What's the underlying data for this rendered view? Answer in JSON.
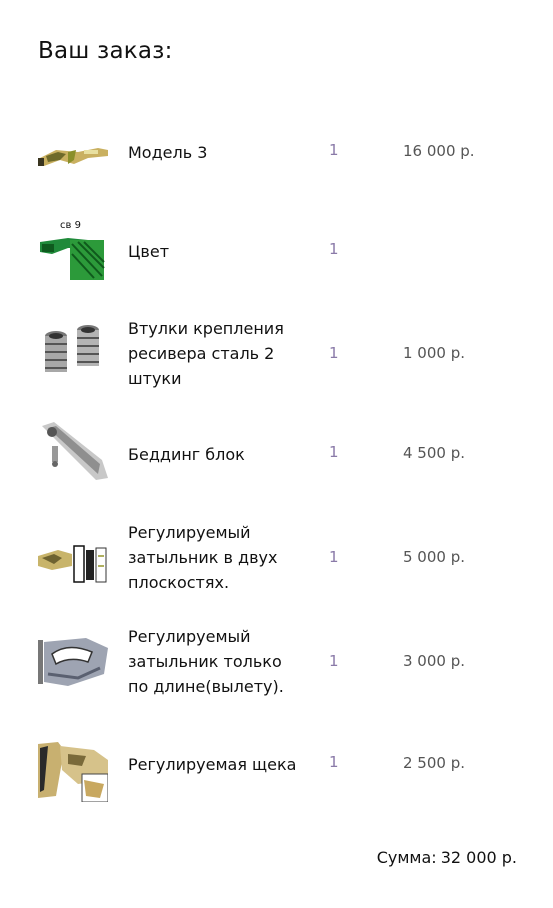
{
  "order": {
    "title": "Ваш заказ:",
    "items": [
      {
        "name": "Модель 3",
        "quantity": "1",
        "price": "16 000 р.",
        "thumbnail_icon": "rifle-stock-icon"
      },
      {
        "name": "Цвет",
        "quantity": "1",
        "price": "",
        "thumbnail_icon": "color-swatch-icon",
        "thumbnail_caption": "св 9"
      },
      {
        "name": "Втулки крепления ресивера сталь 2 штуки",
        "quantity": "1",
        "price": "1 000 р.",
        "thumbnail_icon": "steel-bushings-icon"
      },
      {
        "name": "Беддинг блок",
        "quantity": "1",
        "price": "4 500 р.",
        "thumbnail_icon": "bedding-block-icon"
      },
      {
        "name": "Регулируемый затыльник в двух плоскостях.",
        "quantity": "1",
        "price": "5 000 р.",
        "thumbnail_icon": "adjustable-buttplate-icon"
      },
      {
        "name": "Регулируемый затыльник только по длине(вылету).",
        "quantity": "1",
        "price": "3 000 р.",
        "thumbnail_icon": "length-buttplate-icon"
      },
      {
        "name": "Регулируемая щека",
        "quantity": "1",
        "price": "2 500 р.",
        "thumbnail_icon": "cheek-riser-icon"
      }
    ],
    "total_label": "Сумма:",
    "total_value": "32 000 р."
  }
}
